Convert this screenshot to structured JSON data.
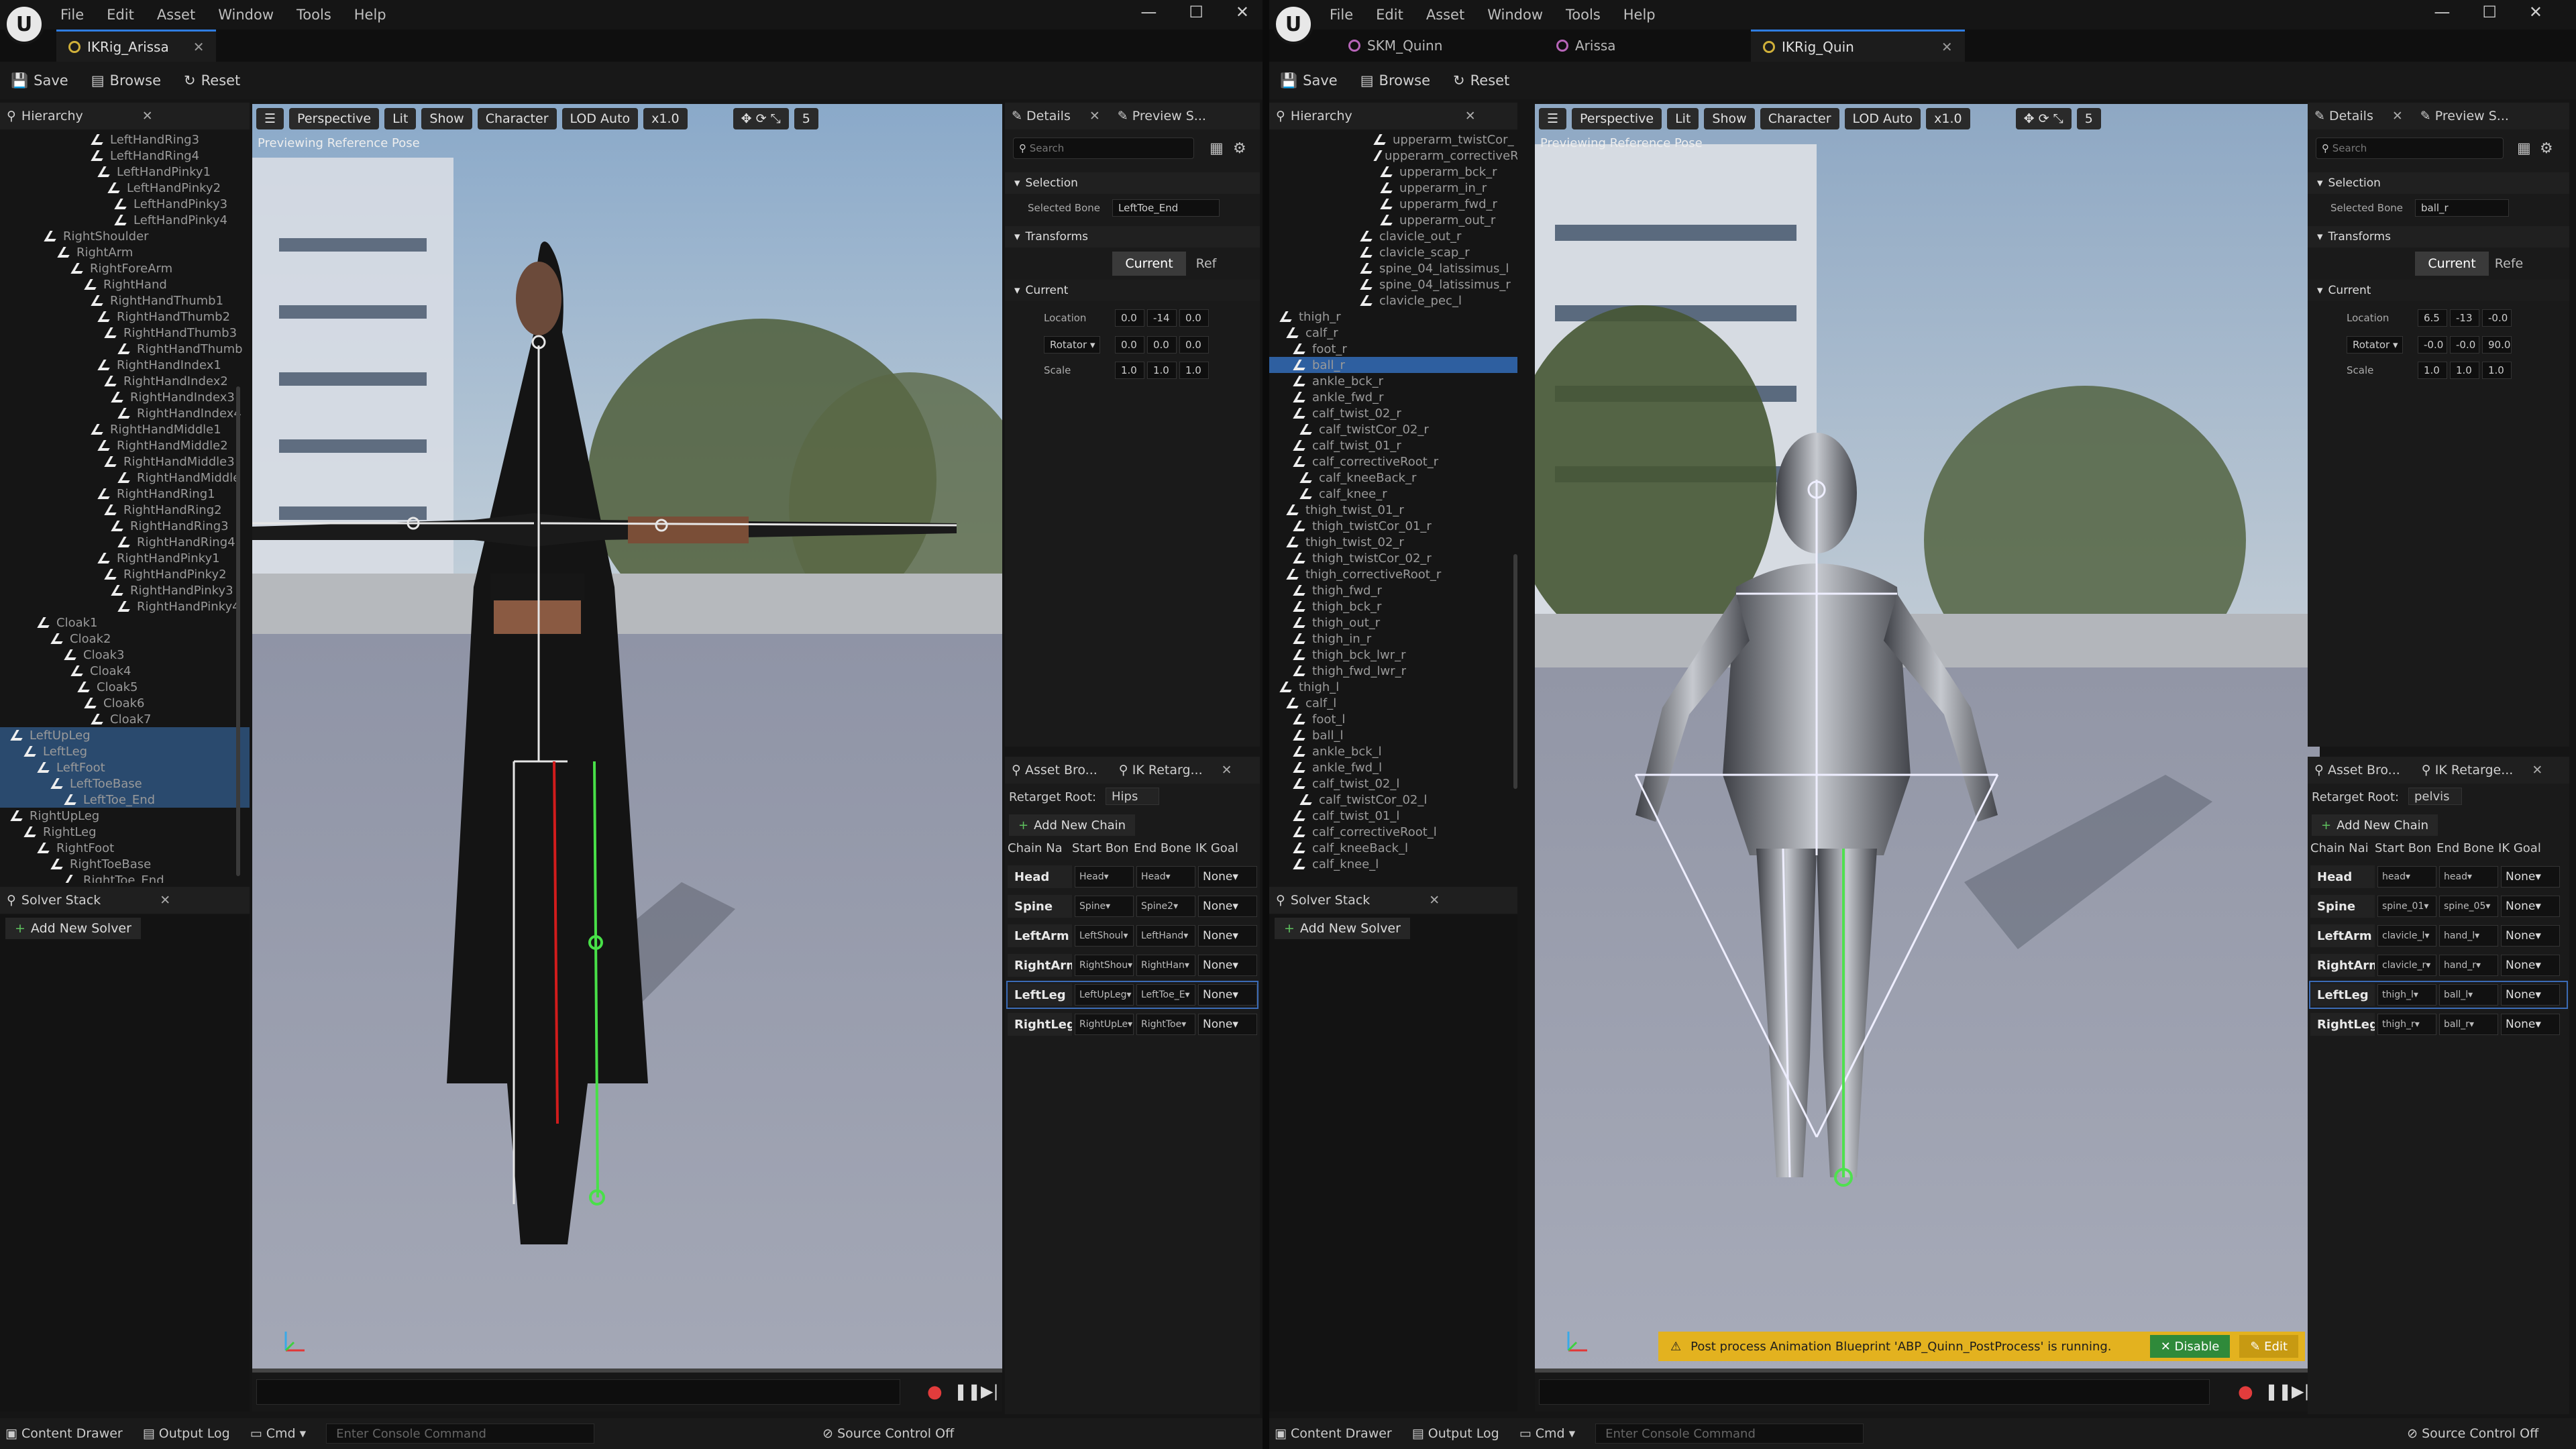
{
  "left_window": {
    "menu": [
      "File",
      "Edit",
      "Asset",
      "Window",
      "Tools",
      "Help"
    ],
    "tab": "IKRig_Arissa",
    "toolbar": {
      "save": "Save",
      "browse": "Browse",
      "reset": "Reset"
    },
    "hierarchy": {
      "title": "Hierarchy",
      "rows": [
        "LeftHandRing3",
        "LeftHandRing4",
        "LeftHandPinky1",
        "LeftHandPinky2",
        "LeftHandPinky3",
        "LeftHandPinky4",
        "RightShoulder",
        "RightArm",
        "RightForeArm",
        "RightHand",
        "RightHandThumb1",
        "RightHandThumb2",
        "RightHandThumb3",
        "RightHandThumb",
        "RightHandIndex1",
        "RightHandIndex2",
        "RightHandIndex3",
        "RightHandIndex4",
        "RightHandMiddle1",
        "RightHandMiddle2",
        "RightHandMiddle3",
        "RightHandMiddle",
        "RightHandRing1",
        "RightHandRing2",
        "RightHandRing3",
        "RightHandRing4",
        "RightHandPinky1",
        "RightHandPinky2",
        "RightHandPinky3",
        "RightHandPinky4",
        "Cloak1",
        "Cloak2",
        "Cloak3",
        "Cloak4",
        "Cloak5",
        "Cloak6",
        "Cloak7",
        "LeftUpLeg",
        "LeftLeg",
        "LeftFoot",
        "LeftToeBase",
        "LeftToe_End",
        "RightUpLeg",
        "RightLeg",
        "RightFoot",
        "RightToeBase",
        "RightToe_End"
      ]
    },
    "solver": {
      "title": "Solver Stack",
      "add": "Add New Solver"
    },
    "viewport": {
      "perspective": "Perspective",
      "lit": "Lit",
      "show": "Show",
      "character": "Character",
      "lod": "LOD Auto",
      "speed": "x1.0",
      "grid": "5",
      "previewing": "Previewing Reference Pose"
    },
    "details": {
      "tab": "Details",
      "tab2": "Preview S...",
      "search": "Search",
      "selection": "Selection",
      "selected_bone_label": "Selected Bone",
      "selected_bone": "LeftToe_End",
      "transforms": "Transforms",
      "current_btn": "Current",
      "ref_btn": "Ref",
      "current": "Current",
      "location": "Location",
      "rotator": "Rotator",
      "scale": "Scale",
      "loc": [
        "0.0",
        "-14",
        "0.0"
      ],
      "rot": [
        "0.0",
        "0.0",
        "0.0"
      ],
      "scl": [
        "1.0",
        "1.0",
        "1.0"
      ]
    },
    "retarget": {
      "tab1": "Asset Bro...",
      "tab2": "IK Retarg...",
      "root_label": "Retarget Root:",
      "root": "Hips",
      "add": "Add New Chain",
      "headers": [
        "Chain Na",
        "Start Bon",
        "End Bone",
        "IK Goal"
      ],
      "chains": [
        [
          "Head",
          "Head",
          "Head",
          "None"
        ],
        [
          "Spine",
          "Spine",
          "Spine2",
          "None"
        ],
        [
          "LeftArm",
          "LeftShoul",
          "LeftHand",
          "None"
        ],
        [
          "RightArm",
          "RightShou",
          "RightHan",
          "None"
        ],
        [
          "LeftLeg",
          "LeftUpLeg",
          "LeftToe_E",
          "None"
        ],
        [
          "RightLeg",
          "RightUpLe",
          "RightToe",
          "None"
        ]
      ]
    },
    "bottom": {
      "drawer": "Content Drawer",
      "output": "Output Log",
      "cmd": "Cmd",
      "console": "Enter Console Command",
      "source": "Source Control Off"
    }
  },
  "right_window": {
    "menu": [
      "File",
      "Edit",
      "Asset",
      "Window",
      "Tools",
      "Help"
    ],
    "tabs": [
      "SKM_Quinn",
      "Arissa",
      "IKRig_Quin"
    ],
    "toolbar": {
      "save": "Save",
      "browse": "Browse",
      "reset": "Reset"
    },
    "hierarchy": {
      "title": "Hierarchy",
      "rows": [
        "upperarm_twistCor_",
        "upperarm_correctiveR",
        "upperarm_bck_r",
        "upperarm_in_r",
        "upperarm_fwd_r",
        "upperarm_out_r",
        "clavicle_out_r",
        "clavicle_scap_r",
        "spine_04_latissimus_l",
        "spine_04_latissimus_r",
        "clavicle_pec_l",
        "thigh_r",
        "calf_r",
        "foot_r",
        "ball_r",
        "ankle_bck_r",
        "ankle_fwd_r",
        "calf_twist_02_r",
        "calf_twistCor_02_r",
        "calf_twist_01_r",
        "calf_correctiveRoot_r",
        "calf_kneeBack_r",
        "calf_knee_r",
        "thigh_twist_01_r",
        "thigh_twistCor_01_r",
        "thigh_twist_02_r",
        "thigh_twistCor_02_r",
        "thigh_correctiveRoot_r",
        "thigh_fwd_r",
        "thigh_bck_r",
        "thigh_out_r",
        "thigh_in_r",
        "thigh_bck_lwr_r",
        "thigh_fwd_lwr_r",
        "thigh_l",
        "calf_l",
        "foot_l",
        "ball_l",
        "ankle_bck_l",
        "ankle_fwd_l",
        "calf_twist_02_l",
        "calf_twistCor_02_l",
        "calf_twist_01_l",
        "calf_correctiveRoot_l",
        "calf_kneeBack_l",
        "calf_knee_l"
      ]
    },
    "solver": {
      "title": "Solver Stack",
      "add": "Add New Solver"
    },
    "viewport": {
      "perspective": "Perspective",
      "lit": "Lit",
      "show": "Show",
      "character": "Character",
      "lod": "LOD Auto",
      "speed": "x1.0",
      "grid": "5",
      "previewing": "Previewing Reference Pose",
      "notice": "Post process Animation Blueprint 'ABP_Quinn_PostProcess' is running.",
      "disable": "Disable",
      "edit": "Edit"
    },
    "details": {
      "tab": "Details",
      "tab2": "Preview S...",
      "search": "Search",
      "selection": "Selection",
      "selected_bone_label": "Selected Bone",
      "selected_bone": "ball_r",
      "transforms": "Transforms",
      "current_btn": "Current",
      "ref_btn": "Refe",
      "current": "Current",
      "location": "Location",
      "rotator": "Rotator",
      "scale": "Scale",
      "loc": [
        "6.5",
        "-13",
        "-0.0"
      ],
      "rot": [
        "-0.0",
        "-0.0",
        "90.0"
      ],
      "scl": [
        "1.0",
        "1.0",
        "1.0"
      ]
    },
    "retarget": {
      "tab1": "Asset Bro...",
      "tab2": "IK Retarge...",
      "root_label": "Retarget Root:",
      "root": "pelvis",
      "add": "Add New Chain",
      "headers": [
        "Chain Nai",
        "Start Bon",
        "End Bone",
        "IK Goal"
      ],
      "chains": [
        [
          "Head",
          "head",
          "head",
          "None"
        ],
        [
          "Spine",
          "spine_01",
          "spine_05",
          "None"
        ],
        [
          "LeftArm",
          "clavicle_l",
          "hand_l",
          "None"
        ],
        [
          "RightArm",
          "clavicle_r",
          "hand_r",
          "None"
        ],
        [
          "LeftLeg",
          "thigh_l",
          "ball_l",
          "None"
        ],
        [
          "RightLeg",
          "thigh_r",
          "ball_r",
          "None"
        ]
      ]
    },
    "bottom": {
      "drawer": "Content Drawer",
      "output": "Output Log",
      "cmd": "Cmd",
      "console": "Enter Console Command",
      "source": "Source Control Off"
    }
  }
}
